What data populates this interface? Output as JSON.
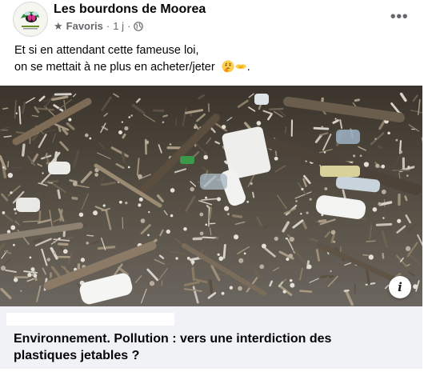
{
  "header": {
    "page_name": "Les bourdons de Moorea",
    "favorites_label": "Favoris",
    "separator": "·",
    "time": "1 j",
    "separator2": "·",
    "more_label": "•••"
  },
  "message": {
    "line1": "Et si en attendant cette fameuse loi,",
    "line2": " on se mettait à ne plus en acheter/jeter",
    "line2_end": "."
  },
  "photo": {
    "info_label": "i"
  },
  "link_preview": {
    "title": "Environnement. Pollution : vers une interdiction des plastiques jetables ?"
  },
  "icons": {
    "avatar": "bumblebee-logo-icon",
    "star": "star-icon",
    "globe": "globe-icon",
    "emoji1": "thinking-face-emoji-icon",
    "emoji2": "handshake-emoji-icon"
  },
  "colors": {
    "text": "#050505",
    "secondary": "#65676b",
    "preview_bg": "#f0f2f5"
  }
}
